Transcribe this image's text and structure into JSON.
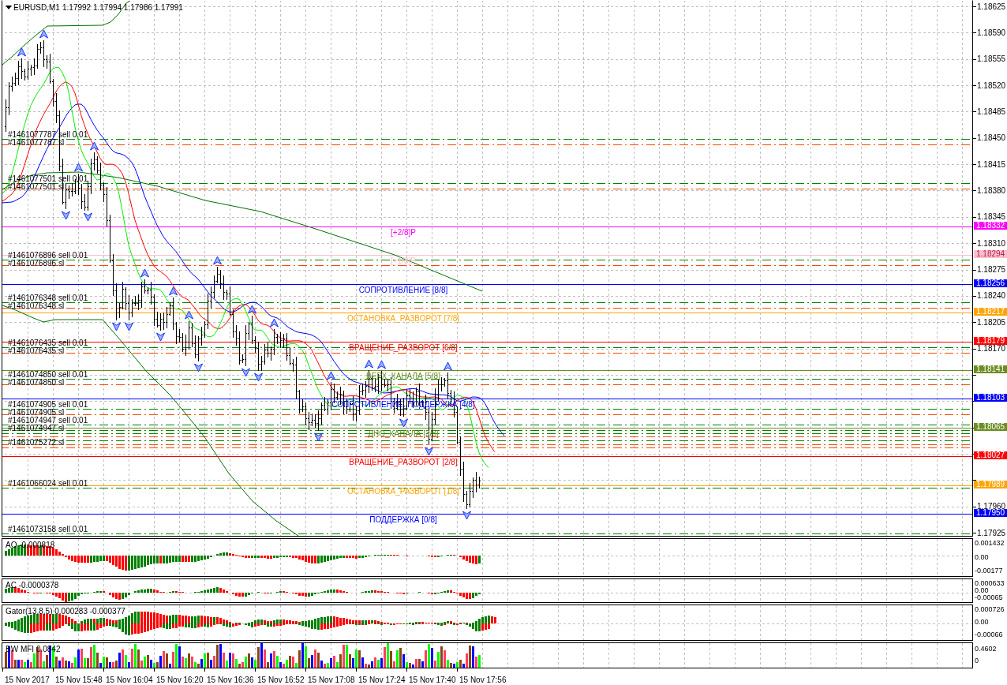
{
  "chart": {
    "symbol": "EURUSD,M1",
    "quote": "1.17992 1.17994 1.17986 1.17991"
  },
  "price_axis": {
    "ticks": [
      "1.18625",
      "1.18590",
      "1.18555",
      "1.18520",
      "1.18485",
      "1.18450",
      "1.18415",
      "1.18380",
      "1.18345",
      "1.18310",
      "1.18275",
      "1.18240",
      "1.18205",
      "1.18170",
      "1.17960",
      "1.17925"
    ]
  },
  "levels": [
    {
      "label": "[+2/8]P",
      "price": "1.18332",
      "color": "#ff00ff"
    },
    {
      "label": "[+1/8]P",
      "price": "1.18294",
      "color": "#ffc0cb"
    },
    {
      "label": "СОПРОТИВЛЕНИЕ [8/8]",
      "price": "1.18256",
      "color": "#0000ff"
    },
    {
      "label": "ОСТАНОВКА_РАЗВОРОТ [7/8]",
      "price": "1.18217",
      "color": "#ffa500"
    },
    {
      "label": "ВРАЩЕНИЕ_РАЗВОРОТ [6/8]",
      "price": "1.18179",
      "color": "#ff0000"
    },
    {
      "label": "ВЕРХ_КАНАЛА [5/8]",
      "price": "1.18141",
      "color": "#6b8e23"
    },
    {
      "label": "СОПРОТИВЛЕНИЕ_ПОДДЕРЖКА [4/8]",
      "price": "1.18103",
      "color": "#0000ff"
    },
    {
      "label": "ДНО_КАНАЛА [3/8]",
      "price": "1.18065",
      "color": "#6b8e23"
    },
    {
      "label": "ВРАЩЕНИЕ_РАЗВОРОТ [2/8]",
      "price": "1.18027",
      "color": "#ff0000"
    },
    {
      "label": "ОСТАНОВКА_РАЗВОРОТ [1/8]",
      "price": "1.17989",
      "color": "#ffa500"
    },
    {
      "label": "ПОДДЕРЖКА [0/8]",
      "price": "1.17950",
      "color": "#0000ff"
    }
  ],
  "orders": [
    {
      "label": "#1461077787 sell 0.01",
      "stop_loss": "#1461077787 sl"
    },
    {
      "label": "#1461077501 sell 0.01",
      "stop_loss": "#1461077501 sl"
    },
    {
      "label": "#1461076896 sell 0.01",
      "stop_loss": "#1461076896 sl"
    },
    {
      "label": "#1461076348 sell 0.01",
      "stop_loss": "#1461076348 sl"
    },
    {
      "label": "#1461076435 sell 0.01",
      "stop_loss": "#1461076435 sl"
    },
    {
      "label": "#1461074850 sell 0.01",
      "stop_loss": "#1461074850 sl"
    },
    {
      "label": "#1461074905 sell 0.01",
      "stop_loss": "#1461074905 sl"
    },
    {
      "label": "#1461074947 sell 0.01",
      "stop_loss": "#1461074947 sl"
    },
    {
      "stop_loss": "#1461075272 sl"
    },
    {
      "label": "#1461066024 sell 0.01"
    },
    {
      "label": "#1461073158 sell 0.01"
    }
  ],
  "indicators": [
    {
      "kind": "ao",
      "label": "AO -0.000818",
      "scale": [
        "0.001432",
        "0.00",
        "-0.00177"
      ]
    },
    {
      "kind": "ac",
      "label": "AC -0.0000378",
      "scale": [
        "0.000633",
        "0.00",
        "-0.00065"
      ]
    },
    {
      "kind": "gator",
      "label": "Gator(13,8,5) 0.000283 -0.000377",
      "scale": [
        "0.000726",
        "0.00",
        "-0.00066"
      ]
    },
    {
      "kind": "mfi",
      "label": "BW MFI 0.0842",
      "scale": [
        "0.4602",
        "0"
      ]
    }
  ],
  "time_axis": [
    "15 Nov 2017",
    "15 Nov 15:48",
    "15 Nov 16:04",
    "15 Nov 16:20",
    "15 Nov 16:36",
    "15 Nov 16:52",
    "15 Nov 17:08",
    "15 Nov 17:24",
    "15 Nov 17:40",
    "15 Nov 17:56"
  ]
}
